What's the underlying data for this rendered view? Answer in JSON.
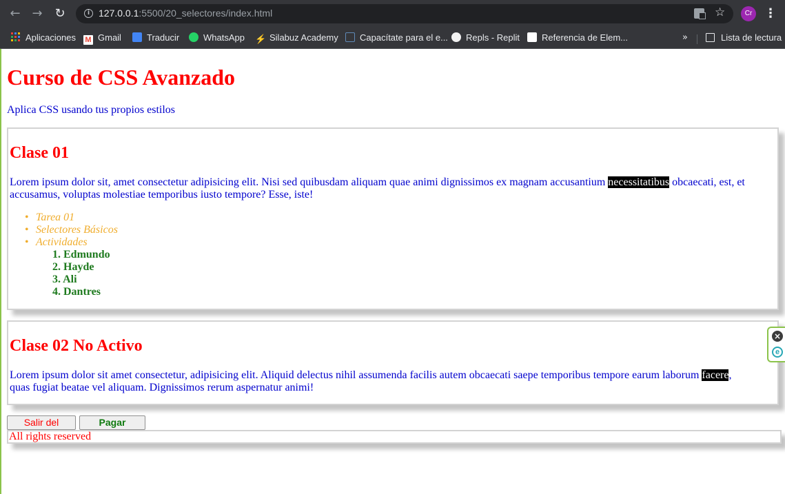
{
  "browser": {
    "url_host": "127.0.0.1",
    "url_rest": ":5500/20_selectores/index.html",
    "avatar_initials": "Cr",
    "bookmarks": [
      {
        "label": "Aplicaciones",
        "icon": "apps-grid-icon"
      },
      {
        "label": "Gmail",
        "icon": "gmail-icon"
      },
      {
        "label": "Traducir",
        "icon": "translate-icon"
      },
      {
        "label": "WhatsApp",
        "icon": "whatsapp-icon"
      },
      {
        "label": "Silabuz Academy",
        "icon": "silabuz-icon"
      },
      {
        "label": "Capacítate para el e...",
        "icon": "edit-page-icon"
      },
      {
        "label": "Repls - Replit",
        "icon": "replit-icon"
      },
      {
        "label": "Referencia de Elem...",
        "icon": "mdn-icon"
      }
    ],
    "reading_list_label": "Lista de lectura",
    "more_bookmarks": "»"
  },
  "page": {
    "title": "Curso de CSS Avanzado",
    "subtitle": "Aplica CSS usando tus propios estilos",
    "class1": {
      "heading": "Clase 01",
      "text_before": "Lorem ipsum dolor sit, amet consectetur adipisicing elit. Nisi sed quibusdam aliquam quae animi dignissimos ex magnam accusantium ",
      "highlight": "necessitatibus",
      "text_after": " obcaecati, est, et accusamus, voluptas molestiae temporibus iusto tempore? Esse, iste!",
      "tasks": [
        "Tarea 01",
        "Selectores Básicos",
        "Actividades"
      ],
      "people": [
        "1. Edmundo",
        "2. Hayde",
        "3. Ali",
        "4. Dantres"
      ]
    },
    "class2": {
      "heading": "Clase 02 No Activo",
      "text_before": "Lorem ipsum dolor sit amet consectetur, adipisicing elit. Aliquid delectus nihil assumenda facilis autem obcaecati saepe temporibus tempore earum laborum ",
      "highlight": "facere",
      "text_after": ", quas fugiat beatae vel aliquam. Dignissimos rerum aspernatur animi!"
    },
    "buttons": {
      "exit": "Salir del curso",
      "pay": "Pagar Curso"
    },
    "footer": "All rights reserved"
  },
  "colors": {
    "heading": "#ff0000",
    "body_text": "#0000cd",
    "list_italic": "#f0ad2d",
    "list_bold": "#1e7a1e",
    "chrome_bg": "#35363a"
  }
}
